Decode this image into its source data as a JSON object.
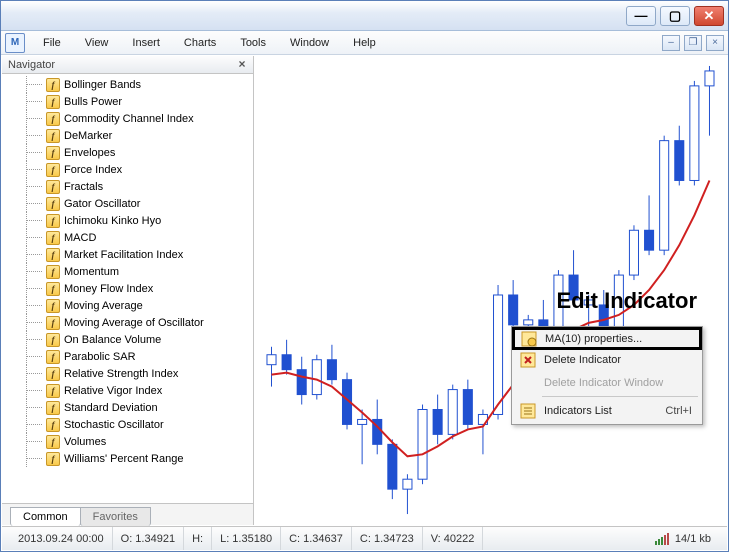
{
  "menus": [
    "File",
    "View",
    "Insert",
    "Charts",
    "Tools",
    "Window",
    "Help"
  ],
  "navigator": {
    "title": "Navigator",
    "items": [
      "Bollinger Bands",
      "Bulls Power",
      "Commodity Channel Index",
      "DeMarker",
      "Envelopes",
      "Force Index",
      "Fractals",
      "Gator Oscillator",
      "Ichimoku Kinko Hyo",
      "MACD",
      "Market Facilitation Index",
      "Momentum",
      "Money Flow Index",
      "Moving Average",
      "Moving Average of Oscillator",
      "On Balance Volume",
      "Parabolic SAR",
      "Relative Strength Index",
      "Relative Vigor Index",
      "Standard Deviation",
      "Stochastic Oscillator",
      "Volumes",
      "Williams' Percent Range"
    ],
    "tabs": {
      "common": "Common",
      "favorites": "Favorites"
    }
  },
  "context_menu": {
    "properties": "MA(10) properties...",
    "delete_ind": "Delete Indicator",
    "delete_win": "Delete Indicator Window",
    "list": "Indicators List",
    "list_sc": "Ctrl+I"
  },
  "annotation": "Edit Indicator",
  "status": {
    "time": "2013.09.24 00:00",
    "o": "O: 1.34921",
    "h": "H:",
    "l": "L: 1.35180",
    "c": "C: 1.34637",
    "c2": "C: 1.34723",
    "v": "V: 40222",
    "kb": "14/1 kb"
  },
  "chart_data": {
    "type": "candlestick",
    "indicator": {
      "name": "MA(10)",
      "color": "#d02020"
    },
    "ohlc": [
      {
        "o": 1.346,
        "h": 1.3478,
        "l": 1.3438,
        "c": 1.347,
        "up": true
      },
      {
        "o": 1.347,
        "h": 1.3485,
        "l": 1.345,
        "c": 1.3455,
        "up": false
      },
      {
        "o": 1.3455,
        "h": 1.3468,
        "l": 1.342,
        "c": 1.343,
        "up": false
      },
      {
        "o": 1.343,
        "h": 1.347,
        "l": 1.3425,
        "c": 1.3465,
        "up": true
      },
      {
        "o": 1.3465,
        "h": 1.348,
        "l": 1.344,
        "c": 1.3445,
        "up": false
      },
      {
        "o": 1.3445,
        "h": 1.3452,
        "l": 1.3395,
        "c": 1.34,
        "up": false
      },
      {
        "o": 1.34,
        "h": 1.3415,
        "l": 1.336,
        "c": 1.3405,
        "up": true
      },
      {
        "o": 1.3405,
        "h": 1.3425,
        "l": 1.337,
        "c": 1.338,
        "up": false
      },
      {
        "o": 1.338,
        "h": 1.3385,
        "l": 1.3325,
        "c": 1.3335,
        "up": false
      },
      {
        "o": 1.3335,
        "h": 1.335,
        "l": 1.331,
        "c": 1.3345,
        "up": true
      },
      {
        "o": 1.3345,
        "h": 1.342,
        "l": 1.334,
        "c": 1.3415,
        "up": true
      },
      {
        "o": 1.3415,
        "h": 1.343,
        "l": 1.338,
        "c": 1.339,
        "up": false
      },
      {
        "o": 1.339,
        "h": 1.344,
        "l": 1.3385,
        "c": 1.3435,
        "up": true
      },
      {
        "o": 1.3435,
        "h": 1.3445,
        "l": 1.3395,
        "c": 1.34,
        "up": false
      },
      {
        "o": 1.34,
        "h": 1.3415,
        "l": 1.337,
        "c": 1.341,
        "up": true
      },
      {
        "o": 1.341,
        "h": 1.354,
        "l": 1.3405,
        "c": 1.353,
        "up": true
      },
      {
        "o": 1.353,
        "h": 1.3545,
        "l": 1.3495,
        "c": 1.35,
        "up": false
      },
      {
        "o": 1.35,
        "h": 1.351,
        "l": 1.346,
        "c": 1.3505,
        "up": true
      },
      {
        "o": 1.3505,
        "h": 1.3525,
        "l": 1.3475,
        "c": 1.348,
        "up": false
      },
      {
        "o": 1.348,
        "h": 1.3555,
        "l": 1.3475,
        "c": 1.355,
        "up": true
      },
      {
        "o": 1.355,
        "h": 1.3575,
        "l": 1.352,
        "c": 1.3525,
        "up": false
      },
      {
        "o": 1.3525,
        "h": 1.353,
        "l": 1.347,
        "c": 1.352,
        "up": true
      },
      {
        "o": 1.352,
        "h": 1.3535,
        "l": 1.349,
        "c": 1.3495,
        "up": false
      },
      {
        "o": 1.3495,
        "h": 1.3555,
        "l": 1.349,
        "c": 1.355,
        "up": true
      },
      {
        "o": 1.355,
        "h": 1.36,
        "l": 1.3545,
        "c": 1.3595,
        "up": true
      },
      {
        "o": 1.3595,
        "h": 1.363,
        "l": 1.357,
        "c": 1.3575,
        "up": false
      },
      {
        "o": 1.3575,
        "h": 1.369,
        "l": 1.357,
        "c": 1.3685,
        "up": true
      },
      {
        "o": 1.3685,
        "h": 1.37,
        "l": 1.364,
        "c": 1.3645,
        "up": false
      },
      {
        "o": 1.3645,
        "h": 1.3745,
        "l": 1.364,
        "c": 1.374,
        "up": true
      },
      {
        "o": 1.374,
        "h": 1.376,
        "l": 1.369,
        "c": 1.3755,
        "up": true
      }
    ],
    "ma10": [
      1.345,
      1.3452,
      1.3448,
      1.3445,
      1.3438,
      1.3425,
      1.3412,
      1.3398,
      1.3382,
      1.3368,
      1.337,
      1.3378,
      1.3388,
      1.3395,
      1.3398,
      1.342,
      1.344,
      1.3455,
      1.3468,
      1.3482,
      1.3495,
      1.3502,
      1.3505,
      1.351,
      1.352,
      1.3535,
      1.3555,
      1.358,
      1.361,
      1.3645
    ]
  }
}
